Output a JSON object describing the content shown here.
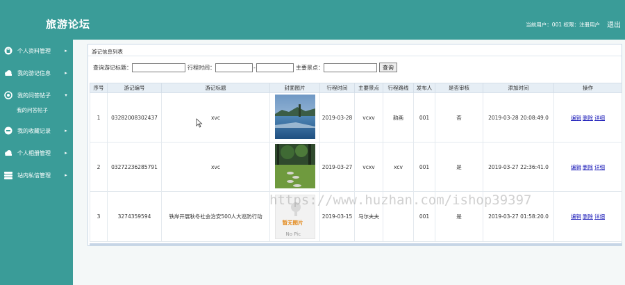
{
  "header": {
    "title": "旅游论坛",
    "user_info": "当前用户：001 权限：注册用户",
    "logout": "退出"
  },
  "sidebar": {
    "items": [
      {
        "label": "个人资料管理",
        "icon": "user-circle-icon",
        "arrow": "▸"
      },
      {
        "label": "我的游记信息",
        "icon": "cloud-icon",
        "arrow": "▸"
      },
      {
        "label": "我的问答帖子",
        "icon": "disc-icon",
        "arrow": "▾"
      },
      {
        "label": "我的收藏记录",
        "icon": "app-badge-icon",
        "arrow": "▸"
      },
      {
        "label": "个人相册管理",
        "icon": "cloud-icon",
        "arrow": "▸"
      },
      {
        "label": "站内私信管理",
        "icon": "stack-icon",
        "arrow": "▸"
      }
    ],
    "sub_item": "我的问答帖子"
  },
  "panel": {
    "title": "游记信息列表"
  },
  "search": {
    "prefix": "查询",
    "title_label": "游记标题：",
    "date_label": "行程时间：",
    "dash": "-",
    "spot_label": "主要景点：",
    "button": "查询",
    "title_value": "",
    "date_from": "",
    "date_to": "",
    "spot_value": ""
  },
  "table": {
    "headers": [
      "序号",
      "游记编号",
      "游记标题",
      "封面图片",
      "行程时间",
      "主要景点",
      "行程路线",
      "发布人",
      "是否审核",
      "添加时间",
      "操作"
    ],
    "rows": [
      {
        "index": "1",
        "code": "03282008302437",
        "title": "xvc",
        "cover": "lake-photo",
        "date": "2019-03-28",
        "spot": "vcxv",
        "route": "韵画",
        "author": "001",
        "audit": "否",
        "added": "2019-03-28 20:08:49.0"
      },
      {
        "index": "2",
        "code": "03272236285791",
        "title": "xvc",
        "cover": "park-photo",
        "date": "2019-03-27",
        "spot": "vcxv",
        "route": "xcv",
        "author": "001",
        "audit": "是",
        "added": "2019-03-27 22:36:41.0"
      },
      {
        "index": "3",
        "code": "3274359594",
        "title": "铁岸开展秋冬社会治安500人大巡防行动",
        "cover": "no-picture",
        "date": "2019-03-15",
        "spot": "马尔夫夫",
        "route": "",
        "author": "001",
        "audit": "是",
        "added": "2019-03-27 01:58:20.0"
      }
    ],
    "actions": {
      "edit": "编辑",
      "delete": "删除",
      "detail": "详细"
    },
    "nopic_cn": "暂无图片",
    "nopic_en": "No Pic"
  },
  "watermark": "https://www.huzhan.com/ishop39397"
}
